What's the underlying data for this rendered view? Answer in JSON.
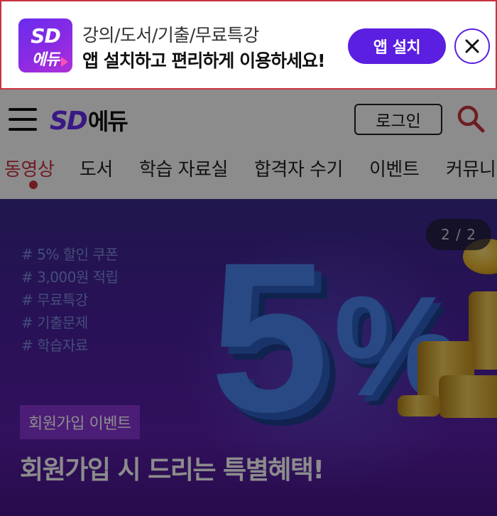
{
  "app_banner": {
    "logo_line1": "SD",
    "logo_line2": "에듀",
    "line1": "강의/도서/기출/무료특강",
    "line2": "앱 설치하고 편리하게 이용하세요!",
    "install_label": "앱 설치",
    "close_icon": "close-icon"
  },
  "header": {
    "menu_icon": "hamburger-menu-icon",
    "logo_latin": "SD",
    "logo_korean": "에듀",
    "login_label": "로그인",
    "search_icon": "search-icon"
  },
  "nav": {
    "items": [
      {
        "label": "동영상",
        "active": true
      },
      {
        "label": "도서",
        "active": false
      },
      {
        "label": "학습 자료실",
        "active": false
      },
      {
        "label": "합격자 수기",
        "active": false
      },
      {
        "label": "이벤트",
        "active": false
      },
      {
        "label": "커뮤니",
        "active": false
      }
    ]
  },
  "hero": {
    "hashtags": [
      "# 5% 할인 쿠폰",
      "# 3,000원 적립",
      "# 무료특강",
      "# 기출문제",
      "# 학습자료"
    ],
    "big_number": "5",
    "big_percent": "%",
    "slide_counter": "2 / 2",
    "badge": "회원가입 이벤트",
    "title": "회원가입 시 드리는 특별혜택!"
  },
  "colors": {
    "brand_purple": "#5a1fe0",
    "accent_red": "#c8333f",
    "hero_bg": "#4a1f9e"
  }
}
